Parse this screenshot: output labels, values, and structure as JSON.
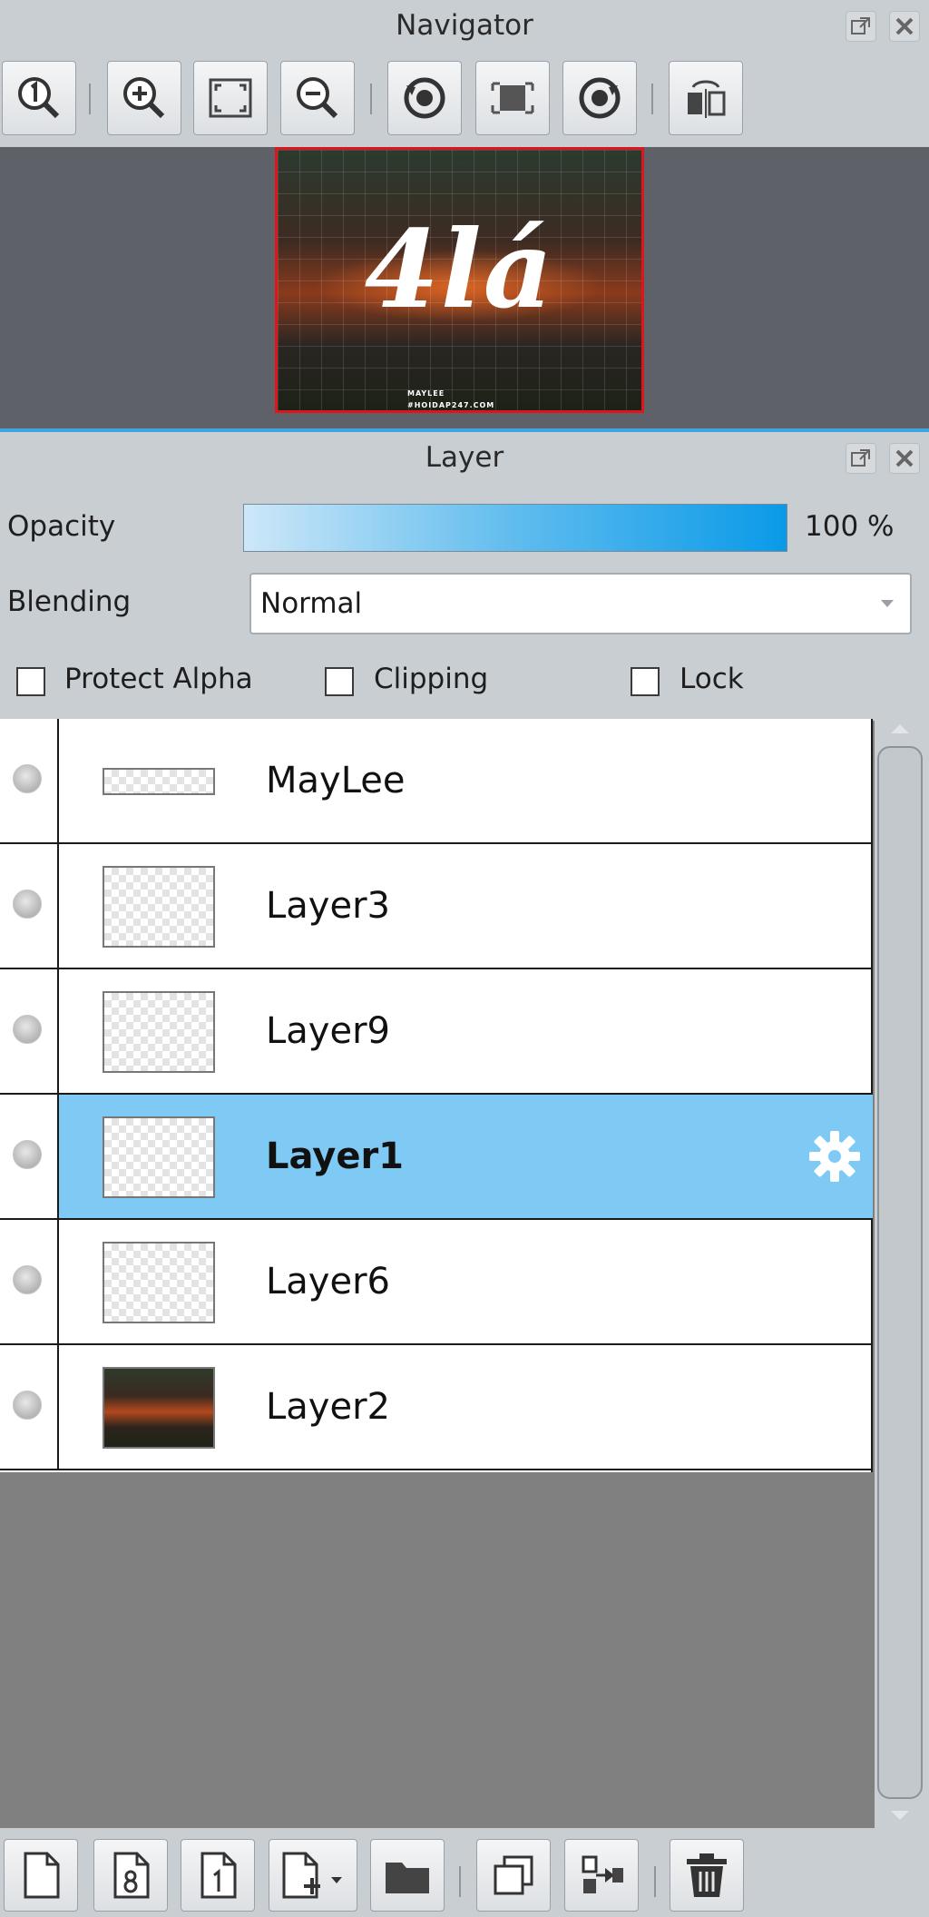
{
  "navigator": {
    "title": "Navigator",
    "preview": {
      "main_text": "4lá",
      "small_text_1": "MAYLEE",
      "small_text_2": "#HOIDAP247.COM"
    }
  },
  "layer": {
    "title": "Layer",
    "opacity_label": "Opacity",
    "opacity_value": "100 %",
    "blending_label": "Blending",
    "blending_value": "Normal",
    "protect_alpha_label": "Protect Alpha",
    "clipping_label": "Clipping",
    "lock_label": "Lock",
    "layers": [
      {
        "name": "MayLee"
      },
      {
        "name": "Layer3"
      },
      {
        "name": "Layer9"
      },
      {
        "name": "Layer1"
      },
      {
        "name": "Layer6"
      },
      {
        "name": "Layer2"
      }
    ]
  },
  "colors": {
    "selection": "#7ecaf4",
    "accent_blue": "#0a9ae8",
    "navigator_frame": "#e0141c"
  }
}
